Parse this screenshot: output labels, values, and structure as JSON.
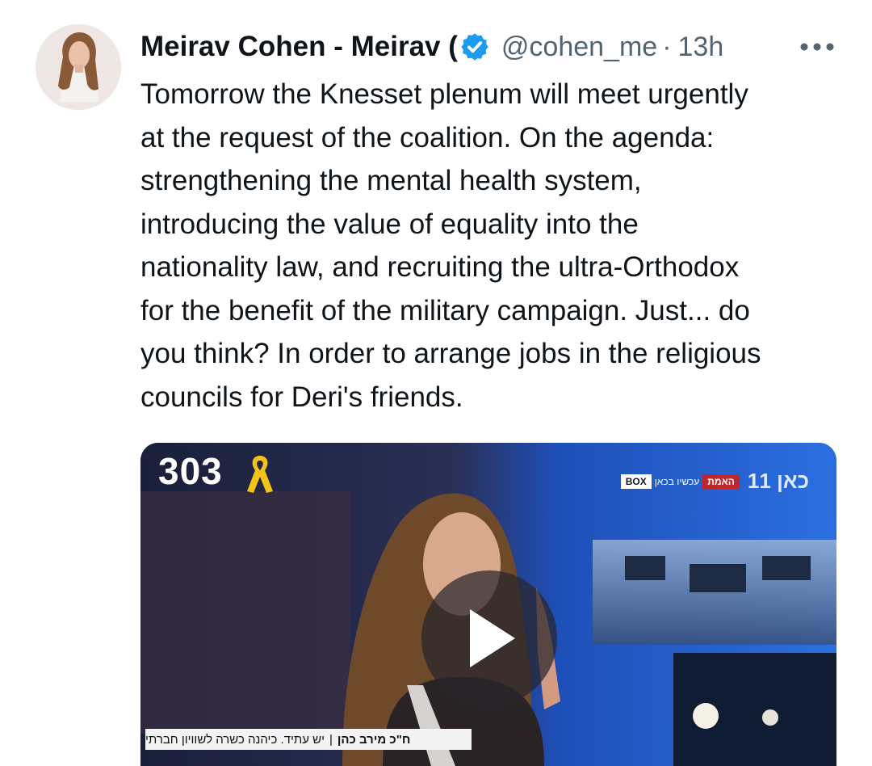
{
  "tweet": {
    "author_name": "Meirav Cohen - Meirav (",
    "verified_icon": "verified-badge-icon",
    "handle": "@cohen_me",
    "separator": "·",
    "time": "13h",
    "more_icon": "more-horizontal-icon",
    "text": "Tomorrow the Knesset plenum will meet urgently\nat the request of the coalition. On the agenda:\nstrengthening the mental health system,\nintroducing the value of equality into the\nnationality law, and recruiting the ultra-Orthodox\nfor the benefit of the military campaign. Just... do\nyou think? In order to arrange jobs in the religious\ncouncils for Deri's friends."
  },
  "media": {
    "counter": "303",
    "ribbon_icon": "yellow-ribbon-icon",
    "play_icon": "play-icon",
    "station_box": "BOX",
    "station_live": "עכשיו בכאן",
    "station_truth": "האמת",
    "station_logo": "כאן 11",
    "lower_third_name": "ח\"כ מירב כהן",
    "lower_third_caption": "יש עתיד. כיהנה כשרה לשוויון חברתי"
  },
  "colors": {
    "text_primary": "#0f1419",
    "text_secondary": "#536471",
    "verified_blue": "#1d9bf0",
    "ribbon_yellow": "#f2c318",
    "live_red": "#c0262d"
  }
}
